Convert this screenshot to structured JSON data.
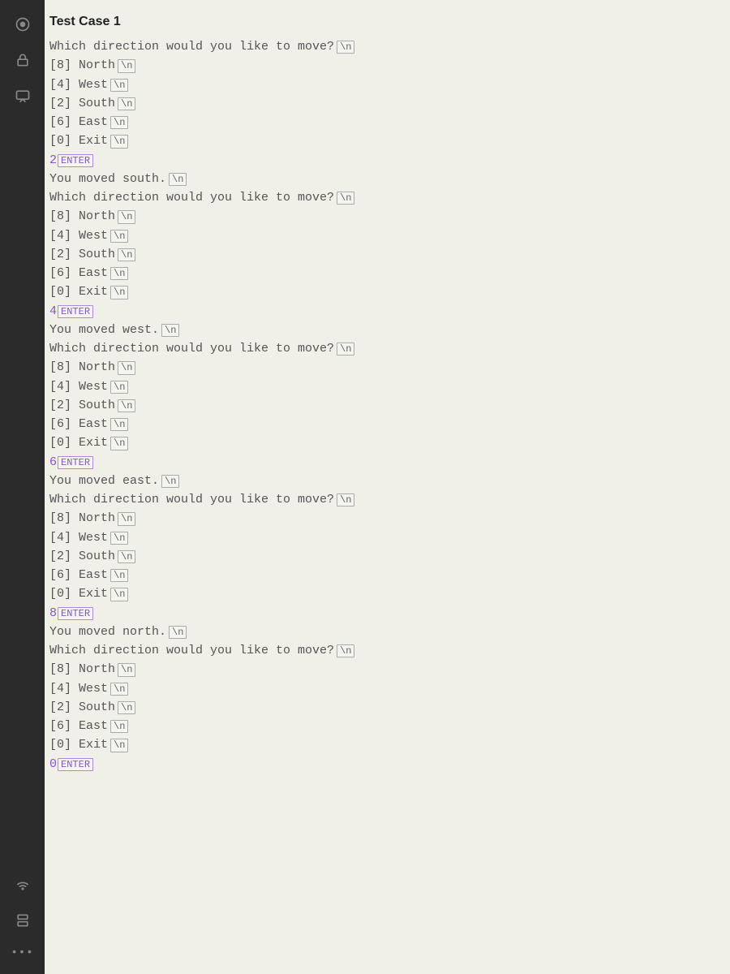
{
  "title": "Test Case 1",
  "tags": {
    "newline": "\\n",
    "enter": "ENTER"
  },
  "menu": {
    "prompt": "Which direction would you like to move?",
    "options": [
      "[8] North",
      "[4] West",
      "[2] South",
      "[6] East",
      "[0] Exit"
    ]
  },
  "iterations": [
    {
      "input": "2",
      "result": "You moved south."
    },
    {
      "input": "4",
      "result": "You moved west."
    },
    {
      "input": "6",
      "result": "You moved east."
    },
    {
      "input": "8",
      "result": "You moved north."
    },
    {
      "input": "0",
      "result": null
    }
  ],
  "sidebar_icons_top": [
    "target-icon",
    "lock-icon",
    "chat-icon"
  ],
  "sidebar_icons_bottom": [
    "wifi-icon",
    "server-icon",
    "ellipsis-icon"
  ]
}
